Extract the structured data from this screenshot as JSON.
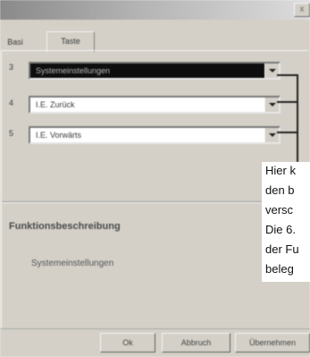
{
  "window": {
    "close_glyph": "x"
  },
  "tabs": [
    {
      "label": "Basi",
      "active": false
    },
    {
      "label": "Taste",
      "active": true
    }
  ],
  "rows": [
    {
      "number": "3",
      "value": "Systemeinstellungen",
      "selected": true
    },
    {
      "number": "4",
      "value": "I.E. Zurück",
      "selected": false
    },
    {
      "number": "5",
      "value": "I.E. Vorwärts",
      "selected": false
    }
  ],
  "description": {
    "title": "Funktionsbeschreibung",
    "value": "Systemeinstellungen"
  },
  "buttons": {
    "ok": "Ok",
    "cancel": "Abbruch",
    "apply": "Übernehmen"
  },
  "note": {
    "lines": [
      "Hier k",
      "den b",
      "versc",
      "Die 6.",
      "der Fu",
      "beleg"
    ]
  }
}
